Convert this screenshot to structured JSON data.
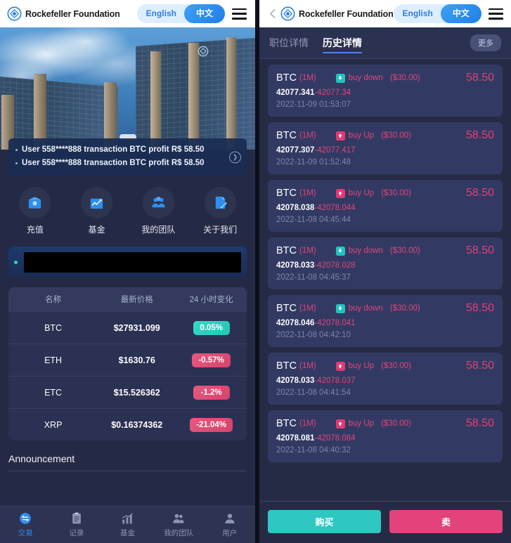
{
  "header": {
    "brand_name": "Rockefeller Foundation",
    "lang_english": "English",
    "lang_chinese": "中文",
    "logo_icon": "diamond-emblem-icon",
    "menu_icon": "hamburger-menu-icon",
    "back_icon": "back-chevron-icon",
    "accent_blue": "#1f7fe8",
    "lang_pill_bg": "#ddeeff"
  },
  "left": {
    "hero": {
      "alt": "glass-office-towers-photo",
      "logo_icon": "building-logo-icon"
    },
    "ticker": {
      "lines": [
        "User 558****888 transaction BTC profit R$ 58.50",
        "User 558****888 transaction BTC profit R$ 58.50"
      ],
      "next_icon": "chevron-right-circle-icon"
    },
    "quick_actions": [
      {
        "label": "充值",
        "icon": "wallet-icon"
      },
      {
        "label": "基金",
        "icon": "chart-growth-icon"
      },
      {
        "label": "我的团队",
        "icon": "people-group-icon"
      },
      {
        "label": "关于我们",
        "icon": "document-pencil-icon"
      }
    ],
    "notice": {
      "status_icon": "green-status-dot",
      "text": ""
    },
    "price_table": {
      "headers": [
        "名称",
        "最新价格",
        "24 小时变化"
      ],
      "rows": [
        {
          "name": "BTC",
          "price": "$27931.099",
          "change": "0.05%",
          "direction": "up"
        },
        {
          "name": "ETH",
          "price": "$1630.76",
          "change": "-0.57%",
          "direction": "down"
        },
        {
          "name": "ETC",
          "price": "$15.526362",
          "change": "-1.2%",
          "direction": "down"
        },
        {
          "name": "XRP",
          "price": "$0.16374362",
          "change": "-21.04%",
          "direction": "down"
        }
      ],
      "up_color": "#2ec7c2",
      "down_color": "#e2437a"
    },
    "announcement": {
      "title": "Announcement"
    },
    "bottom_nav": [
      {
        "label": "交易",
        "icon": "exchange-icon",
        "active": true
      },
      {
        "label": "记录",
        "icon": "clipboard-record-icon",
        "active": false
      },
      {
        "label": "基金",
        "icon": "bar-chart-icon",
        "active": false
      },
      {
        "label": "我的团队",
        "icon": "team-people-icon",
        "active": false
      },
      {
        "label": "用户",
        "icon": "user-profile-icon",
        "active": false
      }
    ]
  },
  "right": {
    "tabs": [
      {
        "label": "职位详情",
        "active": false
      },
      {
        "label": "历史详情",
        "active": true
      }
    ],
    "more_label": "更多",
    "transactions": [
      {
        "symbol": "BTC",
        "period": "(1M)",
        "direction": "buy down",
        "dir_type": "down",
        "amount": "($30.00)",
        "profit": "58.50",
        "open_price": "42077.341",
        "close_price": "42077.34",
        "time": "2022-11-09 01:53:07"
      },
      {
        "symbol": "BTC",
        "period": "(1M)",
        "direction": "buy Up",
        "dir_type": "up",
        "amount": "($30.00)",
        "profit": "58.50",
        "open_price": "42077.307",
        "close_price": "42077.417",
        "time": "2022-11-09 01:52:48"
      },
      {
        "symbol": "BTC",
        "period": "(1M)",
        "direction": "buy Up",
        "dir_type": "up",
        "amount": "($30.00)",
        "profit": "58.50",
        "open_price": "42078.038",
        "close_price": "42078.044",
        "time": "2022-11-08 04:45:44"
      },
      {
        "symbol": "BTC",
        "period": "(1M)",
        "direction": "buy down",
        "dir_type": "down",
        "amount": "($30.00)",
        "profit": "58.50",
        "open_price": "42078.033",
        "close_price": "42078.028",
        "time": "2022-11-08 04:45:37"
      },
      {
        "symbol": "BTC",
        "period": "(1M)",
        "direction": "buy down",
        "dir_type": "down",
        "amount": "($30.00)",
        "profit": "58.50",
        "open_price": "42078.046",
        "close_price": "42078.041",
        "time": "2022-11-08 04:42:10"
      },
      {
        "symbol": "BTC",
        "period": "(1M)",
        "direction": "buy Up",
        "dir_type": "up",
        "amount": "($30.00)",
        "profit": "58.50",
        "open_price": "42078.033",
        "close_price": "42078.037",
        "time": "2022-11-08 04:41:54"
      },
      {
        "symbol": "BTC",
        "period": "(1M)",
        "direction": "buy Up",
        "dir_type": "up",
        "amount": "($30.00)",
        "profit": "58.50",
        "open_price": "42078.081",
        "close_price": "42078.084",
        "time": "2022-11-08 04:40:32"
      }
    ],
    "actions": {
      "buy_label": "购买",
      "sell_label": "卖",
      "buy_color": "#2ec7c2",
      "sell_color": "#e2437a"
    }
  }
}
